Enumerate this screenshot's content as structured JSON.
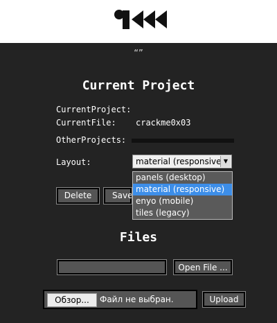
{
  "header": {
    "logo_icon": "r2-logo-icon",
    "subtitle": "“”"
  },
  "project": {
    "title": "Current Project",
    "current_project_label": "CurrentProject:",
    "current_project_value": "",
    "current_file_label": "CurrentFile:",
    "current_file_value": "crackme0x03",
    "other_projects_label": "OtherProjects:",
    "layout_label": "Layout:",
    "layout_selected": "material (responsive)",
    "layout_options": [
      "panels (desktop)",
      "material (responsive)",
      "enyo (mobile)",
      "tiles (legacy)"
    ],
    "delete_label": "Delete",
    "save_label": "Save"
  },
  "files": {
    "title": "Files",
    "open_file_label": "Open File ...",
    "browse_label": "Обзор...",
    "no_file_text": "Файл не выбран.",
    "upload_label": "Upload"
  },
  "colors": {
    "background": "#232323",
    "topbar": "#ffffff",
    "selected_option": "#3d8ee8"
  }
}
